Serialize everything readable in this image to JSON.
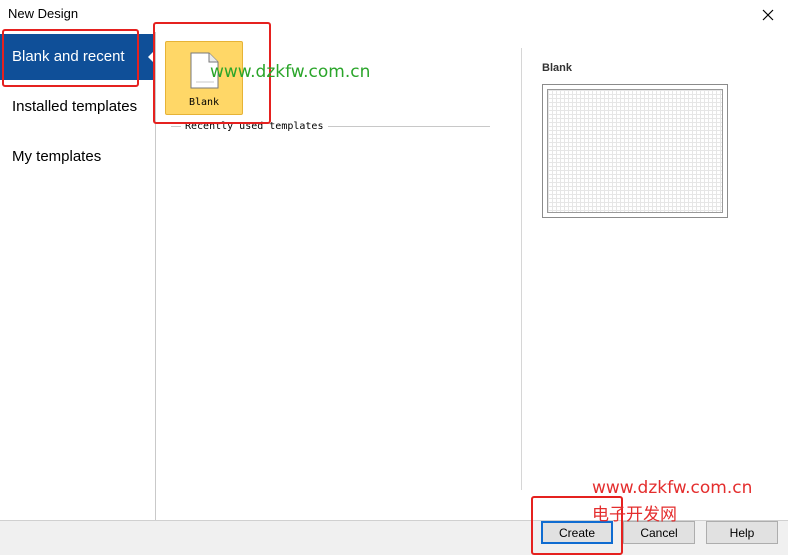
{
  "window": {
    "title": "New Design"
  },
  "sidebar": {
    "items": [
      {
        "label": "Blank and recent"
      },
      {
        "label": "Installed templates"
      },
      {
        "label": "My templates"
      }
    ]
  },
  "content": {
    "tile_label": "Blank",
    "section_label": "Recently used templates"
  },
  "preview": {
    "title": "Blank"
  },
  "buttons": {
    "create": "Create",
    "cancel": "Cancel",
    "help": "Help"
  },
  "watermarks": {
    "top": "www.dzkfw.com.cn",
    "bottom_url": "www.dzkfw.com.cn",
    "bottom_cn": "电子开发网"
  },
  "colors": {
    "selection": "#0f4f98",
    "tile": "#ffd767",
    "annotation": "#e5211f",
    "watermark_green": "#2aa52a",
    "watermark_red": "#e42d2d"
  }
}
